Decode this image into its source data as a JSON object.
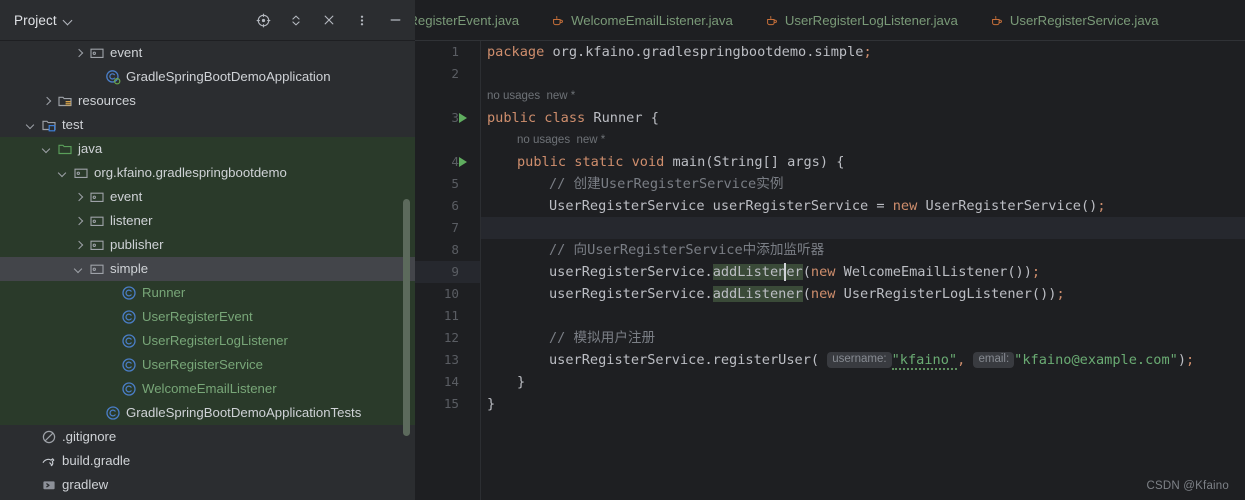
{
  "window": {
    "background": "#1e1f22"
  },
  "tool_window": {
    "title": "Project",
    "dropdown_icon": "chevron-down-icon",
    "actions": [
      {
        "name": "select-opened-file-icon",
        "label": "Select Opened File"
      },
      {
        "name": "expand-collapse-icon",
        "label": "Expand / Collapse"
      },
      {
        "name": "collapse-all-icon",
        "label": "Collapse All"
      },
      {
        "name": "more-options-icon",
        "label": "More Options"
      },
      {
        "name": "hide-icon",
        "label": "Hide"
      }
    ]
  },
  "tree": {
    "items": [
      {
        "label": "event",
        "indent": 5,
        "twisty": "right",
        "icon": "package-icon",
        "style": "white",
        "vcs": false,
        "selected": false
      },
      {
        "label": "GradleSpringBootDemoApplication",
        "indent": 6,
        "twisty": "none",
        "icon": "spring-class-icon",
        "style": "white",
        "vcs": false,
        "selected": false
      },
      {
        "label": "resources",
        "indent": 3,
        "twisty": "right",
        "icon": "resources-folder-icon",
        "style": "white",
        "vcs": false,
        "selected": false
      },
      {
        "label": "test",
        "indent": 2,
        "twisty": "down",
        "icon": "test-folder-icon",
        "style": "white",
        "vcs": false,
        "selected": false
      },
      {
        "label": "java",
        "indent": 3,
        "twisty": "down",
        "icon": "source-folder-icon",
        "style": "white",
        "vcs": true,
        "selected": false
      },
      {
        "label": "org.kfaino.gradlespringbootdemo",
        "indent": 4,
        "twisty": "down",
        "icon": "package-icon",
        "style": "white",
        "vcs": true,
        "selected": false
      },
      {
        "label": "event",
        "indent": 5,
        "twisty": "right",
        "icon": "package-icon",
        "style": "white",
        "vcs": true,
        "selected": false
      },
      {
        "label": "listener",
        "indent": 5,
        "twisty": "right",
        "icon": "package-icon",
        "style": "white",
        "vcs": true,
        "selected": false
      },
      {
        "label": "publisher",
        "indent": 5,
        "twisty": "right",
        "icon": "package-icon",
        "style": "white",
        "vcs": true,
        "selected": false
      },
      {
        "label": "simple",
        "indent": 5,
        "twisty": "down",
        "icon": "package-icon",
        "style": "white",
        "vcs": true,
        "selected": true
      },
      {
        "label": "Runner",
        "indent": 7,
        "twisty": "none",
        "icon": "java-class-icon",
        "style": "green",
        "vcs": true,
        "selected": false
      },
      {
        "label": "UserRegisterEvent",
        "indent": 7,
        "twisty": "none",
        "icon": "java-class-icon",
        "style": "green",
        "vcs": true,
        "selected": false
      },
      {
        "label": "UserRegisterLogListener",
        "indent": 7,
        "twisty": "none",
        "icon": "java-class-icon",
        "style": "green",
        "vcs": true,
        "selected": false
      },
      {
        "label": "UserRegisterService",
        "indent": 7,
        "twisty": "none",
        "icon": "java-class-icon",
        "style": "green",
        "vcs": true,
        "selected": false
      },
      {
        "label": "WelcomeEmailListener",
        "indent": 7,
        "twisty": "none",
        "icon": "java-class-icon",
        "style": "green",
        "vcs": true,
        "selected": false
      },
      {
        "label": "GradleSpringBootDemoApplicationTests",
        "indent": 6,
        "twisty": "none",
        "icon": "java-class-icon",
        "style": "white",
        "vcs": true,
        "selected": false
      },
      {
        "label": ".gitignore",
        "indent": 2,
        "twisty": "none",
        "icon": "gitignore-icon",
        "style": "white",
        "vcs": false,
        "selected": false
      },
      {
        "label": "build.gradle",
        "indent": 2,
        "twisty": "none",
        "icon": "gradle-icon",
        "style": "white",
        "vcs": false,
        "selected": false
      },
      {
        "label": "gradlew",
        "indent": 2,
        "twisty": "none",
        "icon": "script-icon",
        "style": "white",
        "vcs": false,
        "selected": false
      }
    ]
  },
  "tabs": [
    {
      "label": "rRegisterEvent.java",
      "icon": "java-file-icon",
      "clipped": true
    },
    {
      "label": "WelcomeEmailListener.java",
      "icon": "java-file-icon",
      "clipped": false
    },
    {
      "label": "UserRegisterLogListener.java",
      "icon": "java-file-icon",
      "clipped": false
    },
    {
      "label": "UserRegisterService.java",
      "icon": "java-file-icon",
      "clipped": false
    }
  ],
  "editor": {
    "line_numbers": [
      "1",
      "2",
      "3",
      "4",
      "5",
      "6",
      "7",
      "8",
      "9",
      "10",
      "11",
      "12",
      "13",
      "14",
      "15"
    ],
    "current_line": "9",
    "run_markers": [
      "3",
      "4"
    ],
    "inlay_hints": [
      {
        "text": "no usages",
        "extra": "new *"
      },
      {
        "text": "no usages",
        "extra": "new *"
      }
    ],
    "param_hints": [
      "username:",
      "email:"
    ],
    "code": {
      "l1_kw": "package",
      "l1_pkg": " org.kfaino.gradlespringbootdemo.simple",
      "l1_semi": ";",
      "l3_kw": "public class",
      "l3_name": " Runner ",
      "l3_brace": "{",
      "l4_kw": "public static void",
      "l4_name": " main",
      "l4_args": "(String[] args) {",
      "l5_comment": "// 创建UserRegisterService实例",
      "l6_type": "UserRegisterService userRegisterService = ",
      "l6_kw": "new",
      "l6_ctor": " UserRegisterService()",
      "l6_semi": ";",
      "l8_comment": "// 向UserRegisterService中添加监听器",
      "l9_pre": "userRegisterService.",
      "l9_meth": "addListener",
      "l9_open": "(",
      "l9_kw": "new",
      "l9_arg": " WelcomeEmailListener())",
      "l9_semi": ";",
      "l10_pre": "userRegisterService.",
      "l10_meth": "addListener",
      "l10_open": "(",
      "l10_kw": "new",
      "l10_arg": " UserRegisterLogListener())",
      "l10_semi": ";",
      "l12_comment": "// 模拟用户注册",
      "l13_pre": "userRegisterService.registerUser( ",
      "l13_str1": "\"kfaino\"",
      "l13_comma": ", ",
      "l13_str2": "\"kfaino@example.com\"",
      "l13_close": ")",
      "l13_semi": ";",
      "l14_brace": "}",
      "l15_brace": "}"
    }
  },
  "watermark": "CSDN @Kfaino"
}
